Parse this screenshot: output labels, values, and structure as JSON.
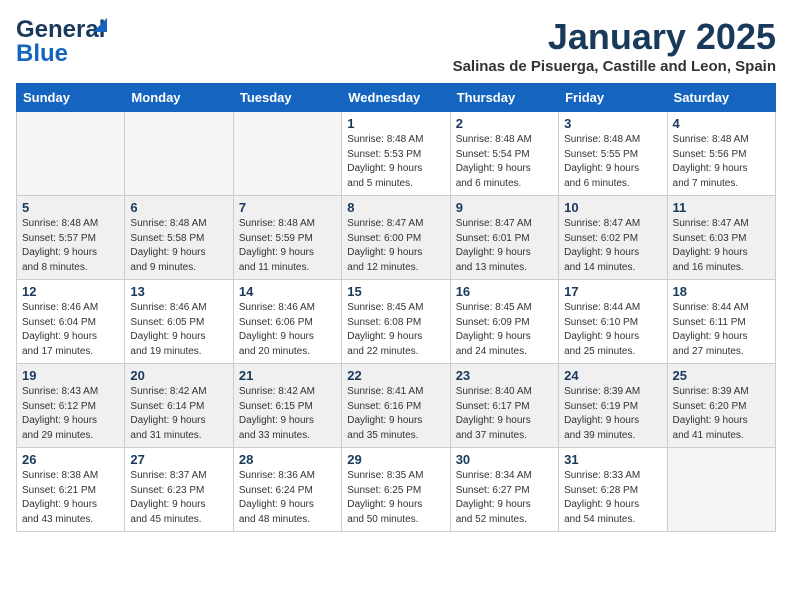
{
  "header": {
    "logo_line1": "General",
    "logo_line2": "Blue",
    "title": "January 2025",
    "location": "Salinas de Pisuerga, Castille and Leon, Spain"
  },
  "days_of_week": [
    "Sunday",
    "Monday",
    "Tuesday",
    "Wednesday",
    "Thursday",
    "Friday",
    "Saturday"
  ],
  "weeks": [
    [
      {
        "num": "",
        "info": ""
      },
      {
        "num": "",
        "info": ""
      },
      {
        "num": "",
        "info": ""
      },
      {
        "num": "1",
        "info": "Sunrise: 8:48 AM\nSunset: 5:53 PM\nDaylight: 9 hours\nand 5 minutes."
      },
      {
        "num": "2",
        "info": "Sunrise: 8:48 AM\nSunset: 5:54 PM\nDaylight: 9 hours\nand 6 minutes."
      },
      {
        "num": "3",
        "info": "Sunrise: 8:48 AM\nSunset: 5:55 PM\nDaylight: 9 hours\nand 6 minutes."
      },
      {
        "num": "4",
        "info": "Sunrise: 8:48 AM\nSunset: 5:56 PM\nDaylight: 9 hours\nand 7 minutes."
      }
    ],
    [
      {
        "num": "5",
        "info": "Sunrise: 8:48 AM\nSunset: 5:57 PM\nDaylight: 9 hours\nand 8 minutes."
      },
      {
        "num": "6",
        "info": "Sunrise: 8:48 AM\nSunset: 5:58 PM\nDaylight: 9 hours\nand 9 minutes."
      },
      {
        "num": "7",
        "info": "Sunrise: 8:48 AM\nSunset: 5:59 PM\nDaylight: 9 hours\nand 11 minutes."
      },
      {
        "num": "8",
        "info": "Sunrise: 8:47 AM\nSunset: 6:00 PM\nDaylight: 9 hours\nand 12 minutes."
      },
      {
        "num": "9",
        "info": "Sunrise: 8:47 AM\nSunset: 6:01 PM\nDaylight: 9 hours\nand 13 minutes."
      },
      {
        "num": "10",
        "info": "Sunrise: 8:47 AM\nSunset: 6:02 PM\nDaylight: 9 hours\nand 14 minutes."
      },
      {
        "num": "11",
        "info": "Sunrise: 8:47 AM\nSunset: 6:03 PM\nDaylight: 9 hours\nand 16 minutes."
      }
    ],
    [
      {
        "num": "12",
        "info": "Sunrise: 8:46 AM\nSunset: 6:04 PM\nDaylight: 9 hours\nand 17 minutes."
      },
      {
        "num": "13",
        "info": "Sunrise: 8:46 AM\nSunset: 6:05 PM\nDaylight: 9 hours\nand 19 minutes."
      },
      {
        "num": "14",
        "info": "Sunrise: 8:46 AM\nSunset: 6:06 PM\nDaylight: 9 hours\nand 20 minutes."
      },
      {
        "num": "15",
        "info": "Sunrise: 8:45 AM\nSunset: 6:08 PM\nDaylight: 9 hours\nand 22 minutes."
      },
      {
        "num": "16",
        "info": "Sunrise: 8:45 AM\nSunset: 6:09 PM\nDaylight: 9 hours\nand 24 minutes."
      },
      {
        "num": "17",
        "info": "Sunrise: 8:44 AM\nSunset: 6:10 PM\nDaylight: 9 hours\nand 25 minutes."
      },
      {
        "num": "18",
        "info": "Sunrise: 8:44 AM\nSunset: 6:11 PM\nDaylight: 9 hours\nand 27 minutes."
      }
    ],
    [
      {
        "num": "19",
        "info": "Sunrise: 8:43 AM\nSunset: 6:12 PM\nDaylight: 9 hours\nand 29 minutes."
      },
      {
        "num": "20",
        "info": "Sunrise: 8:42 AM\nSunset: 6:14 PM\nDaylight: 9 hours\nand 31 minutes."
      },
      {
        "num": "21",
        "info": "Sunrise: 8:42 AM\nSunset: 6:15 PM\nDaylight: 9 hours\nand 33 minutes."
      },
      {
        "num": "22",
        "info": "Sunrise: 8:41 AM\nSunset: 6:16 PM\nDaylight: 9 hours\nand 35 minutes."
      },
      {
        "num": "23",
        "info": "Sunrise: 8:40 AM\nSunset: 6:17 PM\nDaylight: 9 hours\nand 37 minutes."
      },
      {
        "num": "24",
        "info": "Sunrise: 8:39 AM\nSunset: 6:19 PM\nDaylight: 9 hours\nand 39 minutes."
      },
      {
        "num": "25",
        "info": "Sunrise: 8:39 AM\nSunset: 6:20 PM\nDaylight: 9 hours\nand 41 minutes."
      }
    ],
    [
      {
        "num": "26",
        "info": "Sunrise: 8:38 AM\nSunset: 6:21 PM\nDaylight: 9 hours\nand 43 minutes."
      },
      {
        "num": "27",
        "info": "Sunrise: 8:37 AM\nSunset: 6:23 PM\nDaylight: 9 hours\nand 45 minutes."
      },
      {
        "num": "28",
        "info": "Sunrise: 8:36 AM\nSunset: 6:24 PM\nDaylight: 9 hours\nand 48 minutes."
      },
      {
        "num": "29",
        "info": "Sunrise: 8:35 AM\nSunset: 6:25 PM\nDaylight: 9 hours\nand 50 minutes."
      },
      {
        "num": "30",
        "info": "Sunrise: 8:34 AM\nSunset: 6:27 PM\nDaylight: 9 hours\nand 52 minutes."
      },
      {
        "num": "31",
        "info": "Sunrise: 8:33 AM\nSunset: 6:28 PM\nDaylight: 9 hours\nand 54 minutes."
      },
      {
        "num": "",
        "info": ""
      }
    ]
  ]
}
